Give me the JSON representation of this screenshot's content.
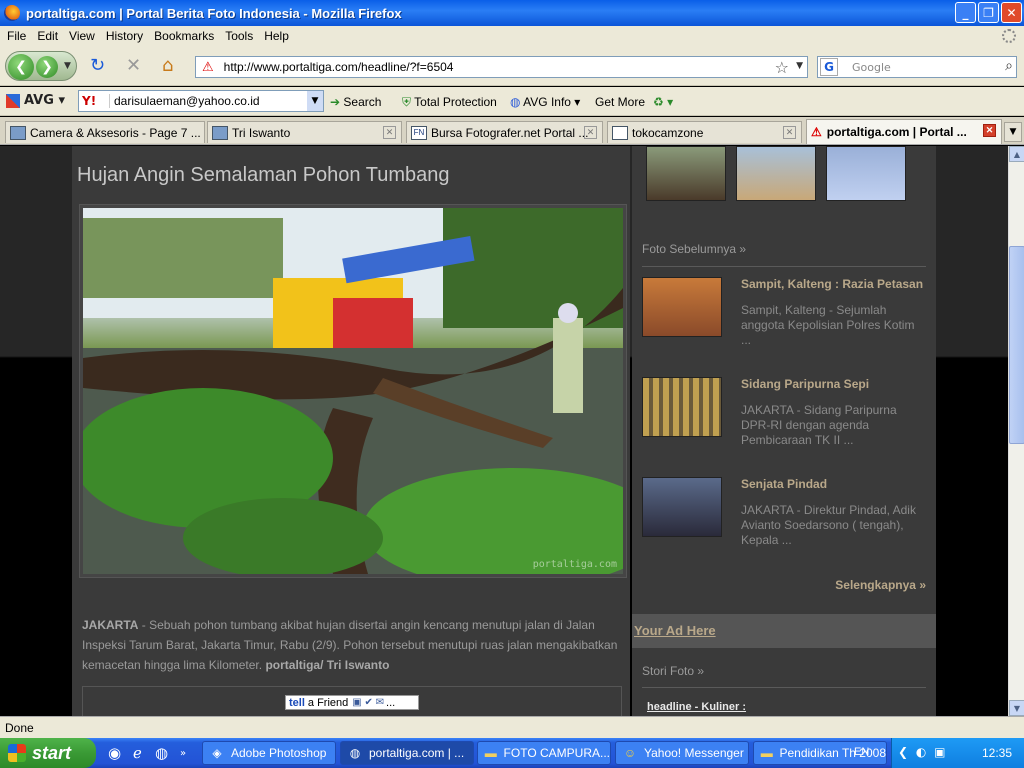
{
  "window": {
    "title": "portaltiga.com | Portal Berita Foto Indonesia - Mozilla Firefox",
    "controls": [
      "_",
      "❐",
      "✕"
    ]
  },
  "menu": [
    "File",
    "Edit",
    "View",
    "History",
    "Bookmarks",
    "Tools",
    "Help"
  ],
  "nav": {
    "url": "http://www.portaltiga.com/headline/?f=6504",
    "search_placeholder": "Google",
    "search_engine_glyph": "G"
  },
  "avg_toolbar": {
    "logo": "AVG",
    "yahoo_glyph": "Y!",
    "email": "darisulaeman@yahoo.co.id",
    "search_label": "Search",
    "total_protection_label": "Total Protection",
    "avg_info_label": "AVG Info",
    "get_more_label": "Get More"
  },
  "tabs": [
    {
      "label": "Camera & Aksesoris - Page 7 ...",
      "icon": "",
      "active": false
    },
    {
      "label": "Tri Iswanto",
      "icon": "",
      "active": false
    },
    {
      "label": "Bursa Fotografer.net Portal ...",
      "icon": "FN",
      "active": false
    },
    {
      "label": "tokocamzone",
      "icon": "",
      "active": false
    },
    {
      "label": "portaltiga.com | Portal ...",
      "icon": "",
      "active": true
    }
  ],
  "article": {
    "headline": "Hujan Angin Semalaman Pohon Tumbang",
    "photo_credit": "portaltiga.com",
    "caption_location": "JAKARTA",
    "caption_body": " - Sebuah pohon tumbang akibat hujan disertai angin kencang menutupi jalan di Jalan Inspeksi Tarum Barat, Jakarta Timur, Rabu (2/9). Pohon tersebut menutupi ruas jalan mengakibatkan kemacetan hingga lima Kilometer. ",
    "caption_credit": "portaltiga/ Tri Iswanto",
    "tell_friend_label": "a Friend",
    "tell_friend_logo": "tell",
    "share_dots": "..."
  },
  "sidebar": {
    "prev_heading": "Foto Sebelumnya »",
    "items": [
      {
        "title": "Sampit, Kalteng : Razia Petasan",
        "desc": "Sampit, Kalteng - Sejumlah anggota Kepolisian Polres Kotim ..."
      },
      {
        "title": "Sidang Paripurna Sepi",
        "desc": "JAKARTA - Sidang Paripurna DPR-RI dengan agenda Pembicaraan TK II ..."
      },
      {
        "title": "Senjata Pindad",
        "desc": "JAKARTA - Direktur Pindad, Adik Avianto Soedarsono ( tengah), Kepala ..."
      }
    ],
    "more_label": "Selengkapnya »",
    "ad_label": "Your Ad Here",
    "story_heading": "Stori Foto »",
    "sub_link": "headline - Kuliner :"
  },
  "status": {
    "text": "Done"
  },
  "taskbar": {
    "start_label": "start",
    "buttons": [
      {
        "label": "Adobe Photoshop",
        "icon": "Ps"
      },
      {
        "label": "portaltiga.com | ...",
        "icon": "ff"
      },
      {
        "label": "FOTO CAMPURA...",
        "icon": "folder"
      },
      {
        "label": "Yahoo! Messenger",
        "icon": "ym"
      },
      {
        "label": "Pendidikan Th 2008",
        "icon": "folder"
      }
    ],
    "lang": "EN",
    "clock": "12:35"
  },
  "colors": {
    "link_accent": "#b9a88a",
    "content_bg": "#3a3a3a",
    "xp_blue": "#245edc"
  }
}
